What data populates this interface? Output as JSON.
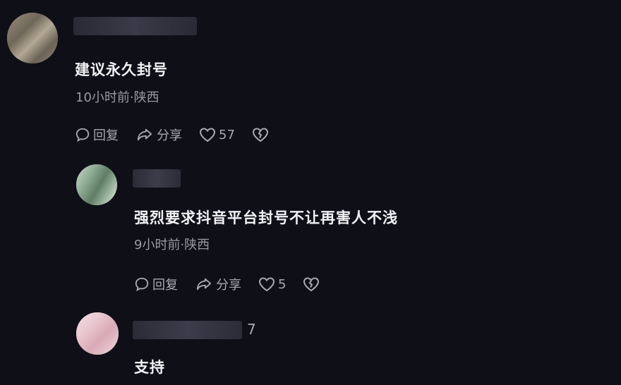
{
  "comments": [
    {
      "text": "建议永久封号",
      "meta": "10小时前·陕西",
      "reply_label": "回复",
      "share_label": "分享",
      "like_count": "57"
    },
    {
      "text": "强烈要求抖音平台封号不让再害人不浅",
      "meta": "9小时前·陕西",
      "reply_label": "回复",
      "share_label": "分享",
      "like_count": "5"
    },
    {
      "name_suffix": "7",
      "text": "支持"
    }
  ],
  "icons": {
    "reply": "comment-bubble-icon",
    "share": "share-arrow-icon",
    "like": "heart-outline-icon",
    "dislike": "broken-heart-icon"
  },
  "colors": {
    "background": "#0f0f18",
    "text": "#f2f2f5",
    "meta": "#9a9aa6"
  }
}
